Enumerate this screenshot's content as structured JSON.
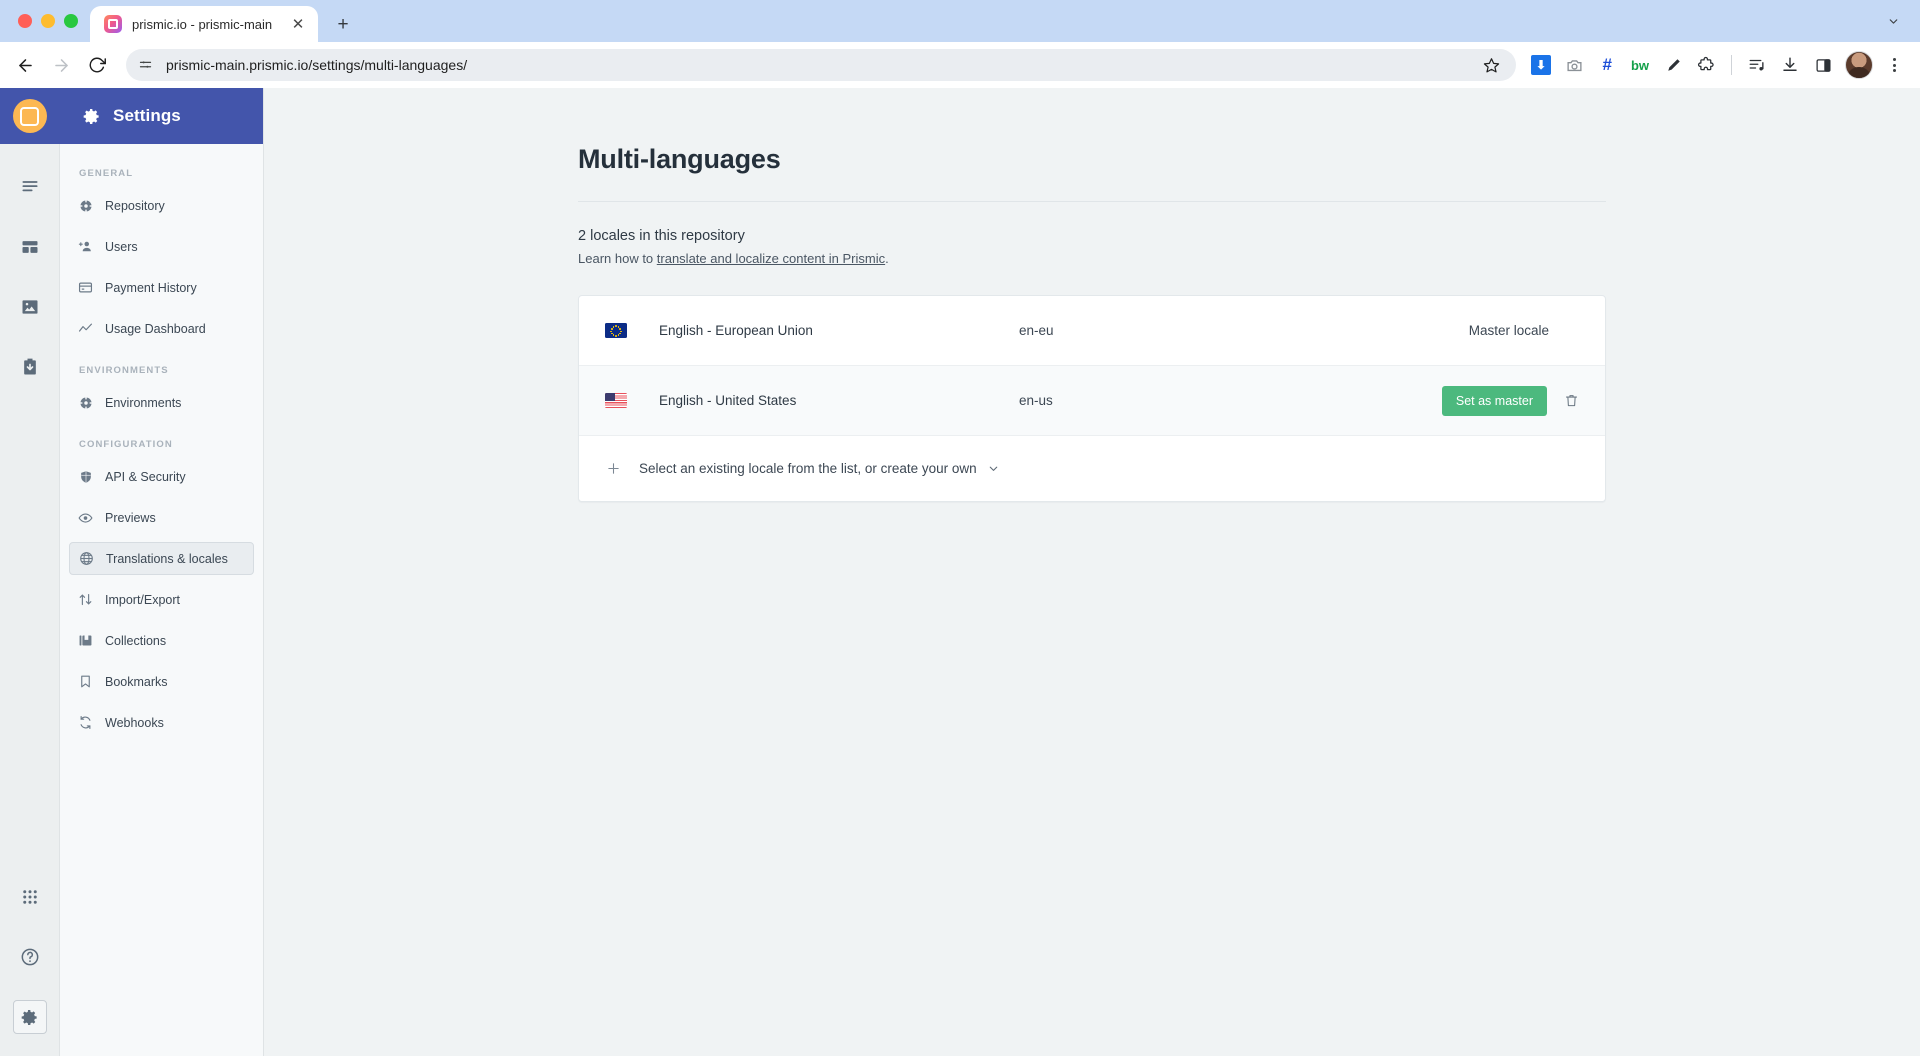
{
  "browser": {
    "tab": {
      "title": "prismic.io - prismic-main",
      "favicon_icon": "prismic-logo-icon",
      "close_icon": "close-icon"
    },
    "new_tab_label": "+",
    "tabstrip_menu_icon": "chevron-down-icon",
    "nav": {
      "back_icon": "back-arrow-icon",
      "forward_icon": "forward-arrow-icon",
      "reload_icon": "reload-icon"
    },
    "omnibox": {
      "site_settings_icon": "site-settings-icon",
      "url": "prismic-main.prismic.io/settings/multi-languages/",
      "bookmark_icon": "star-icon"
    },
    "extensions": [
      {
        "name": "download-blue-extension-icon",
        "glyph": "⬇"
      },
      {
        "name": "screenshot-camera-extension-icon",
        "glyph": "□"
      },
      {
        "name": "hashtag-extension-icon",
        "glyph": "#"
      },
      {
        "name": "bw-extension-icon",
        "glyph": "bw"
      },
      {
        "name": "pen-marker-extension-icon",
        "glyph": "✐"
      },
      {
        "name": "puzzle-extensions-icon",
        "glyph": "⬟"
      }
    ],
    "extensions_right": [
      {
        "name": "reading-list-icon",
        "glyph": "♪"
      },
      {
        "name": "downloads-icon",
        "glyph": "⬇"
      },
      {
        "name": "side-panel-icon",
        "glyph": "▧"
      }
    ],
    "profile_icon": "profile-avatar-icon",
    "menu_icon": "kebab-menu-icon"
  },
  "rail": {
    "logo_icon": "prismic-logo-icon",
    "items": [
      {
        "name": "documents-icon",
        "label": "Documents"
      },
      {
        "name": "custom-types-icon",
        "label": "Custom Types"
      },
      {
        "name": "media-library-icon",
        "label": "Media Library"
      },
      {
        "name": "releases-icon",
        "label": "Releases"
      }
    ],
    "bottom": [
      {
        "name": "apps-grid-icon",
        "label": "Apps"
      },
      {
        "name": "help-circle-icon",
        "label": "Help"
      },
      {
        "name": "settings-gear-icon",
        "label": "Settings",
        "selected": true
      }
    ]
  },
  "sidebar": {
    "header": {
      "title": "Settings",
      "icon": "gear-icon"
    },
    "groups": [
      {
        "label": "GENERAL",
        "items": [
          {
            "label": "Repository",
            "icon": "repository-icon",
            "active": false
          },
          {
            "label": "Users",
            "icon": "add-user-icon",
            "active": false
          },
          {
            "label": "Payment History",
            "icon": "credit-card-icon",
            "active": false
          },
          {
            "label": "Usage Dashboard",
            "icon": "chart-line-icon",
            "active": false
          }
        ]
      },
      {
        "label": "ENVIRONMENTS",
        "items": [
          {
            "label": "Environments",
            "icon": "environments-icon",
            "active": false
          }
        ]
      },
      {
        "label": "CONFIGURATION",
        "items": [
          {
            "label": "API & Security",
            "icon": "shield-icon",
            "active": false
          },
          {
            "label": "Previews",
            "icon": "eye-icon",
            "active": false
          },
          {
            "label": "Translations & locales",
            "icon": "globe-icon",
            "active": true
          },
          {
            "label": "Import/Export",
            "icon": "import-export-icon",
            "active": false
          },
          {
            "label": "Collections",
            "icon": "collections-icon",
            "active": false
          },
          {
            "label": "Bookmarks",
            "icon": "bookmark-icon",
            "active": false
          },
          {
            "label": "Webhooks",
            "icon": "webhooks-icon",
            "active": false
          }
        ]
      }
    ]
  },
  "main": {
    "title": "Multi-languages",
    "summary_count": "2 locales in this repository",
    "learn_prefix": "Learn how to ",
    "learn_link": "translate and localize content in Prismic",
    "learn_suffix": ".",
    "locales": [
      {
        "flag": "eu-flag-icon",
        "name": "English - European Union",
        "code": "en-eu",
        "status": "Master locale",
        "is_master": true
      },
      {
        "flag": "us-flag-icon",
        "name": "English - United States",
        "code": "en-us",
        "action_label": "Set as master",
        "delete_icon": "trash-icon",
        "is_master": false
      }
    ],
    "add_row": {
      "plus_icon": "plus-icon",
      "label": "Select an existing locale from the list, or create your own",
      "chevron_icon": "chevron-down-icon"
    }
  },
  "colors": {
    "brand_purple": "#4355ab",
    "accent_orange": "#fcb853",
    "success_green": "#4cb97e",
    "page_bg": "#f0f3f4",
    "sidebar_bg": "#f7f9fa"
  }
}
